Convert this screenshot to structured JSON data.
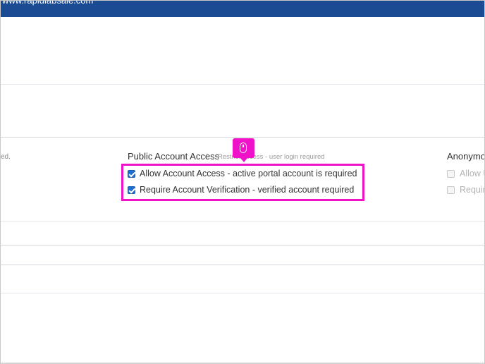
{
  "topbar": {
    "url_text": "www.rapidlabsale.com"
  },
  "left_section": {
    "truncated_hint": "ed."
  },
  "public_account_access": {
    "title": "Public Account Access",
    "hint": "Restrict access - user login required",
    "options": [
      {
        "label": "Allow Account Access - active portal account is required",
        "checked": true
      },
      {
        "label": "Require Account Verification - verified account required",
        "checked": true
      }
    ]
  },
  "anonymous_access": {
    "title": "Anonymo",
    "options": [
      {
        "label": "Allow U",
        "checked": false
      },
      {
        "label": "Requir",
        "checked": false
      }
    ]
  },
  "annotation": {
    "highlight_color": "#ef12c8",
    "icon": "mouse-icon"
  },
  "colors": {
    "topbar": "#1a4b93",
    "checkbox": "#1f6fd1"
  }
}
